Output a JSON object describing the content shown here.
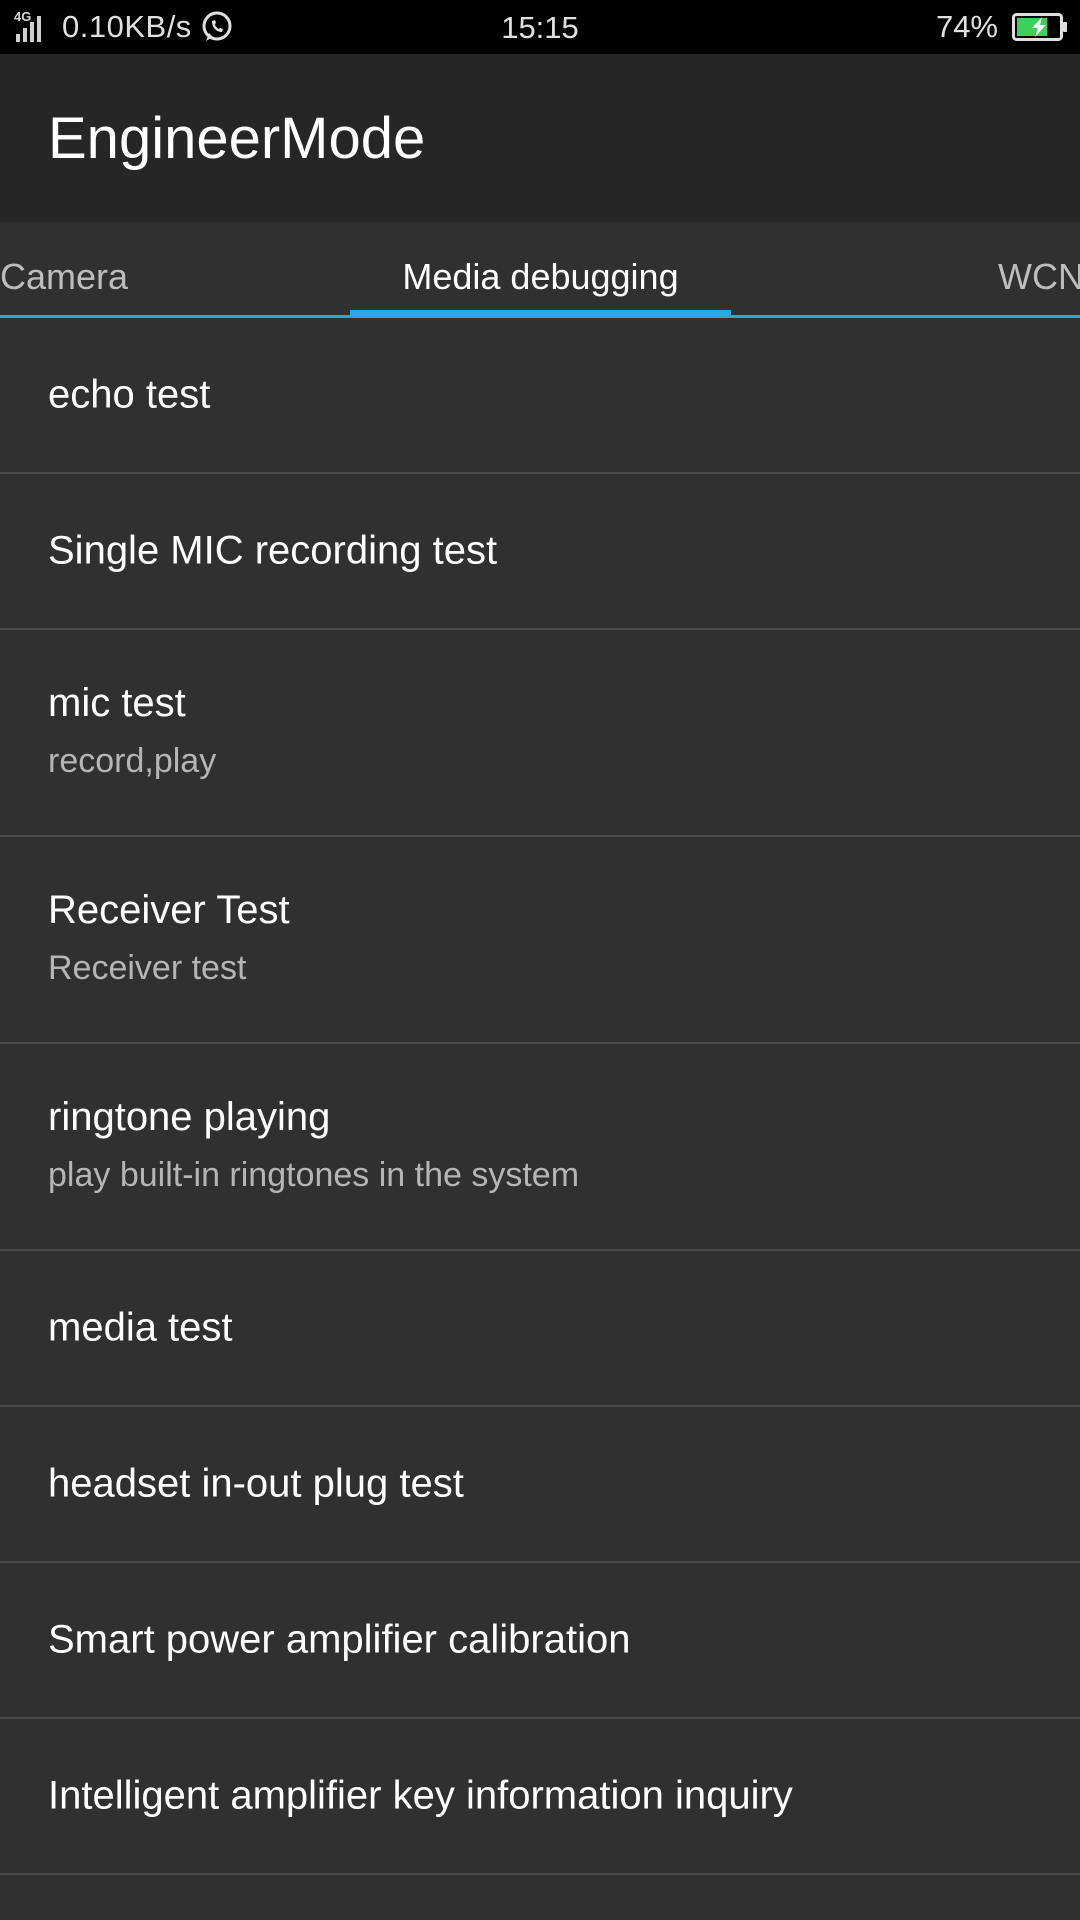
{
  "status_bar": {
    "network_type": "4G",
    "speed": "0.10KB/s",
    "time": "15:15",
    "battery_percent": "74%",
    "battery_level": 0.74,
    "notification_icons": [
      "signal-icon",
      "whatsapp-icon"
    ],
    "battery_color": "#3ccf5a"
  },
  "app_bar": {
    "title": "EngineerMode"
  },
  "tabs": [
    {
      "label": "Camera",
      "selected": false
    },
    {
      "label": "Media debugging",
      "selected": true
    },
    {
      "label": "WCN",
      "selected": false
    }
  ],
  "colors": {
    "accent": "#29a8e0",
    "background": "#303030",
    "app_bar": "#262626"
  },
  "items": [
    {
      "title": "echo test"
    },
    {
      "title": "Single MIC recording test"
    },
    {
      "title": "mic test",
      "subtitle": "record,play"
    },
    {
      "title": "Receiver Test",
      "subtitle": "Receiver test"
    },
    {
      "title": "ringtone playing",
      "subtitle": "play built-in ringtones in the system"
    },
    {
      "title": "media test"
    },
    {
      "title": "headset in-out plug test"
    },
    {
      "title": "Smart power amplifier calibration"
    },
    {
      "title": "Intelligent amplifier key information inquiry"
    }
  ]
}
